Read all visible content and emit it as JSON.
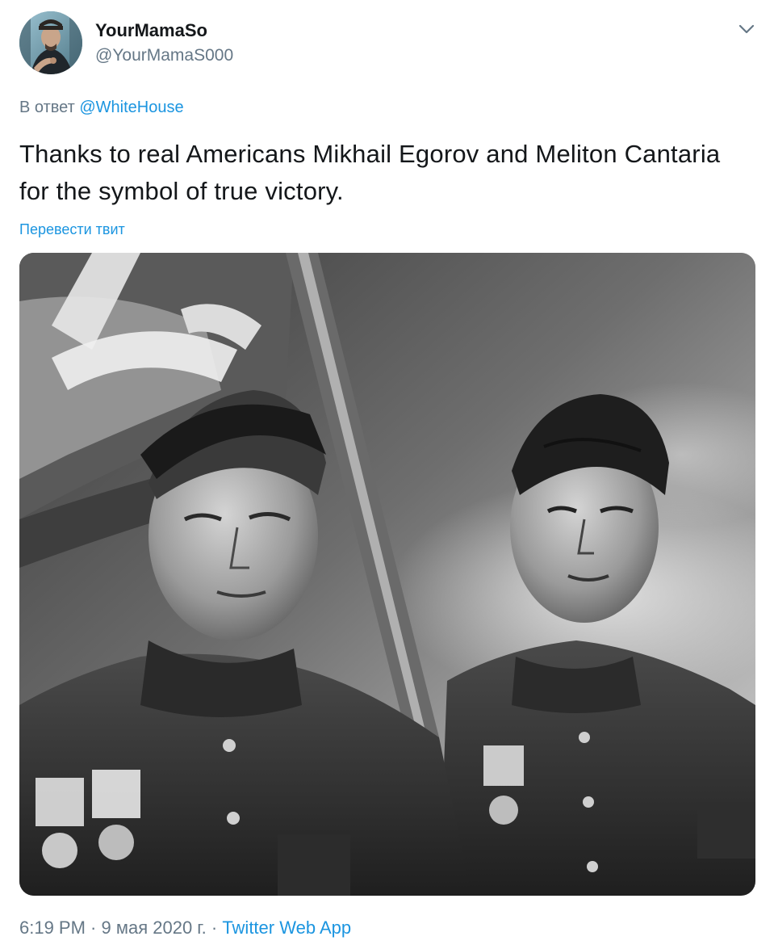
{
  "user": {
    "display_name": "YourMamaSo",
    "handle": "@YourMamaS000",
    "avatar_icon": "avatar-portrait"
  },
  "reply": {
    "prefix": "В ответ",
    "mention": "@WhiteHouse"
  },
  "tweet": {
    "text": "Thanks to real Americans Mikhail Egorov and Meliton Cantaria for the symbol of true victory.",
    "translate_label": "Перевести твит"
  },
  "media": {
    "kind": "black-and-white photograph"
  },
  "meta": {
    "time": "6:19 PM",
    "separator1": " · ",
    "date": "9 мая 2020 г.",
    "separator2": " · ",
    "source": "Twitter Web App"
  },
  "icons": {
    "menu": "chevron-down-icon"
  },
  "colors": {
    "text": "#14171a",
    "secondary": "#657786",
    "link": "#1b95e0"
  }
}
